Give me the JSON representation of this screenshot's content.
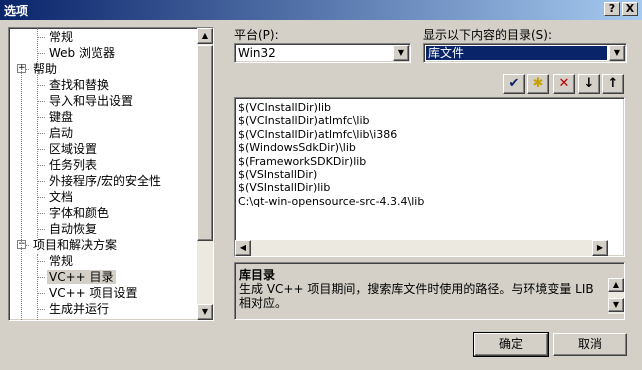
{
  "window": {
    "title": "选项",
    "help_label": "?",
    "close_label": "X"
  },
  "tree": {
    "items": [
      {
        "label": "常规"
      },
      {
        "label": "Web 浏览器"
      },
      {
        "label": "帮助",
        "expander": "+"
      },
      {
        "label": "查找和替换"
      },
      {
        "label": "导入和导出设置"
      },
      {
        "label": "键盘"
      },
      {
        "label": "启动"
      },
      {
        "label": "区域设置"
      },
      {
        "label": "任务列表"
      },
      {
        "label": "外接程序/宏的安全性"
      },
      {
        "label": "文档"
      },
      {
        "label": "字体和颜色"
      },
      {
        "label": "自动恢复"
      },
      {
        "label": "项目和解决方案",
        "expander": "−"
      },
      {
        "label": "常规"
      },
      {
        "label": "VC++ 目录",
        "selected": true
      },
      {
        "label": "VC++ 项目设置"
      },
      {
        "label": "生成并运行"
      }
    ]
  },
  "platform": {
    "label": "平台(P):",
    "value": "Win32"
  },
  "dirs": {
    "label": "显示以下内容的目录(S):",
    "value": "库文件"
  },
  "toolbar": {
    "check_icon": "✔",
    "new_folder_icon": "✱",
    "delete_icon": "✕",
    "down_icon": "↓",
    "up_icon": "↑"
  },
  "list": {
    "items": [
      "$(VCInstallDir)lib",
      "$(VCInstallDir)atlmfc\\lib",
      "$(VCInstallDir)atlmfc\\lib\\i386",
      "$(WindowsSdkDir)\\lib",
      "$(FrameworkSDKDir)lib",
      "$(VSInstallDir)",
      "$(VSInstallDir)lib",
      "C:\\qt-win-opensource-src-4.3.4\\lib"
    ]
  },
  "description": {
    "title": "库目录",
    "text": "生成 VC++ 项目期间，搜索库文件时使用的路径。与环境变量 LIB 相对应。"
  },
  "buttons": {
    "ok": "确定",
    "cancel": "取消"
  },
  "scroll": {
    "up": "▲",
    "down": "▼",
    "left": "◀",
    "right": "▶"
  },
  "colors": {
    "title_bar": "#0a246a",
    "selection": "#0a246a",
    "face": "#d4d0c8"
  }
}
